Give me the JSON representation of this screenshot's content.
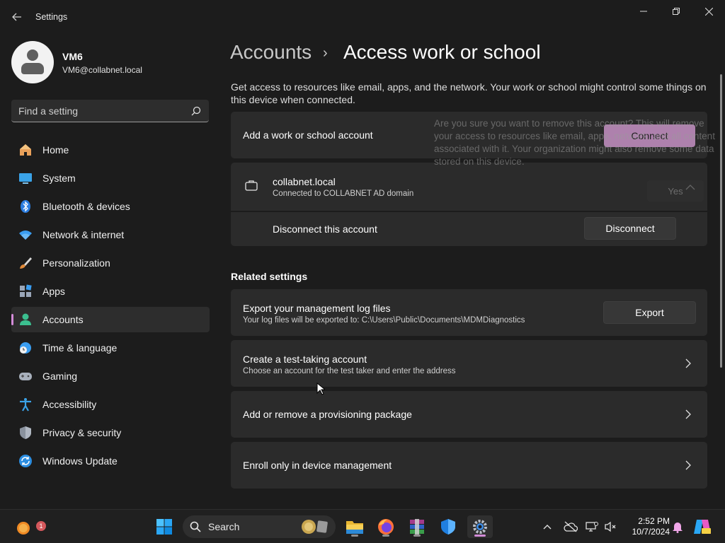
{
  "window": {
    "title": "Settings"
  },
  "profile": {
    "name": "VM6",
    "email": "VM6@collabnet.local"
  },
  "search": {
    "placeholder": "Find a setting"
  },
  "sidebar": {
    "items": [
      {
        "label": "Home",
        "icon": "home-icon"
      },
      {
        "label": "System",
        "icon": "system-icon"
      },
      {
        "label": "Bluetooth & devices",
        "icon": "bluetooth-icon"
      },
      {
        "label": "Network & internet",
        "icon": "wifi-icon"
      },
      {
        "label": "Personalization",
        "icon": "brush-icon"
      },
      {
        "label": "Apps",
        "icon": "apps-icon"
      },
      {
        "label": "Accounts",
        "icon": "accounts-icon",
        "selected": true
      },
      {
        "label": "Time & language",
        "icon": "globe-clock-icon"
      },
      {
        "label": "Gaming",
        "icon": "gamepad-icon"
      },
      {
        "label": "Accessibility",
        "icon": "accessibility-icon"
      },
      {
        "label": "Privacy & security",
        "icon": "shield-icon"
      },
      {
        "label": "Windows Update",
        "icon": "update-icon"
      }
    ]
  },
  "breadcrumb": {
    "parent": "Accounts",
    "separator": "›",
    "current": "Access work or school"
  },
  "description": "Get access to resources like email, apps, and the network. Your work or school might control some things on this device when connected.",
  "add_account": {
    "label": "Add a work or school account",
    "button": "Connect"
  },
  "overlay": {
    "text": "Are you sure you want to remove this account? This will remove your access to resources like email, apps, network, and all content associated with it. Your organization might also remove some data stored on this device.",
    "yes": "Yes"
  },
  "account": {
    "name": "collabnet.local",
    "status": "Connected to COLLABNET AD domain",
    "disconnect_label": "Disconnect this account",
    "disconnect_button": "Disconnect"
  },
  "related": {
    "heading": "Related settings",
    "export": {
      "title": "Export your management log files",
      "subtitle": "Your log files will be exported to: C:\\Users\\Public\\Documents\\MDMDiagnostics",
      "button": "Export"
    },
    "test_account": {
      "title": "Create a test-taking account",
      "subtitle": "Choose an account for the test taker and enter the address"
    },
    "provisioning": {
      "title": "Add or remove a provisioning package"
    },
    "enroll": {
      "title": "Enroll only in device management"
    }
  },
  "taskbar": {
    "search_label": "Search",
    "notification_count": "1",
    "time": "2:52 PM",
    "date": "10/7/2024"
  },
  "colors": {
    "accent": "#d38bd8",
    "background": "#1c1c1c",
    "card": "#2b2b2b"
  }
}
